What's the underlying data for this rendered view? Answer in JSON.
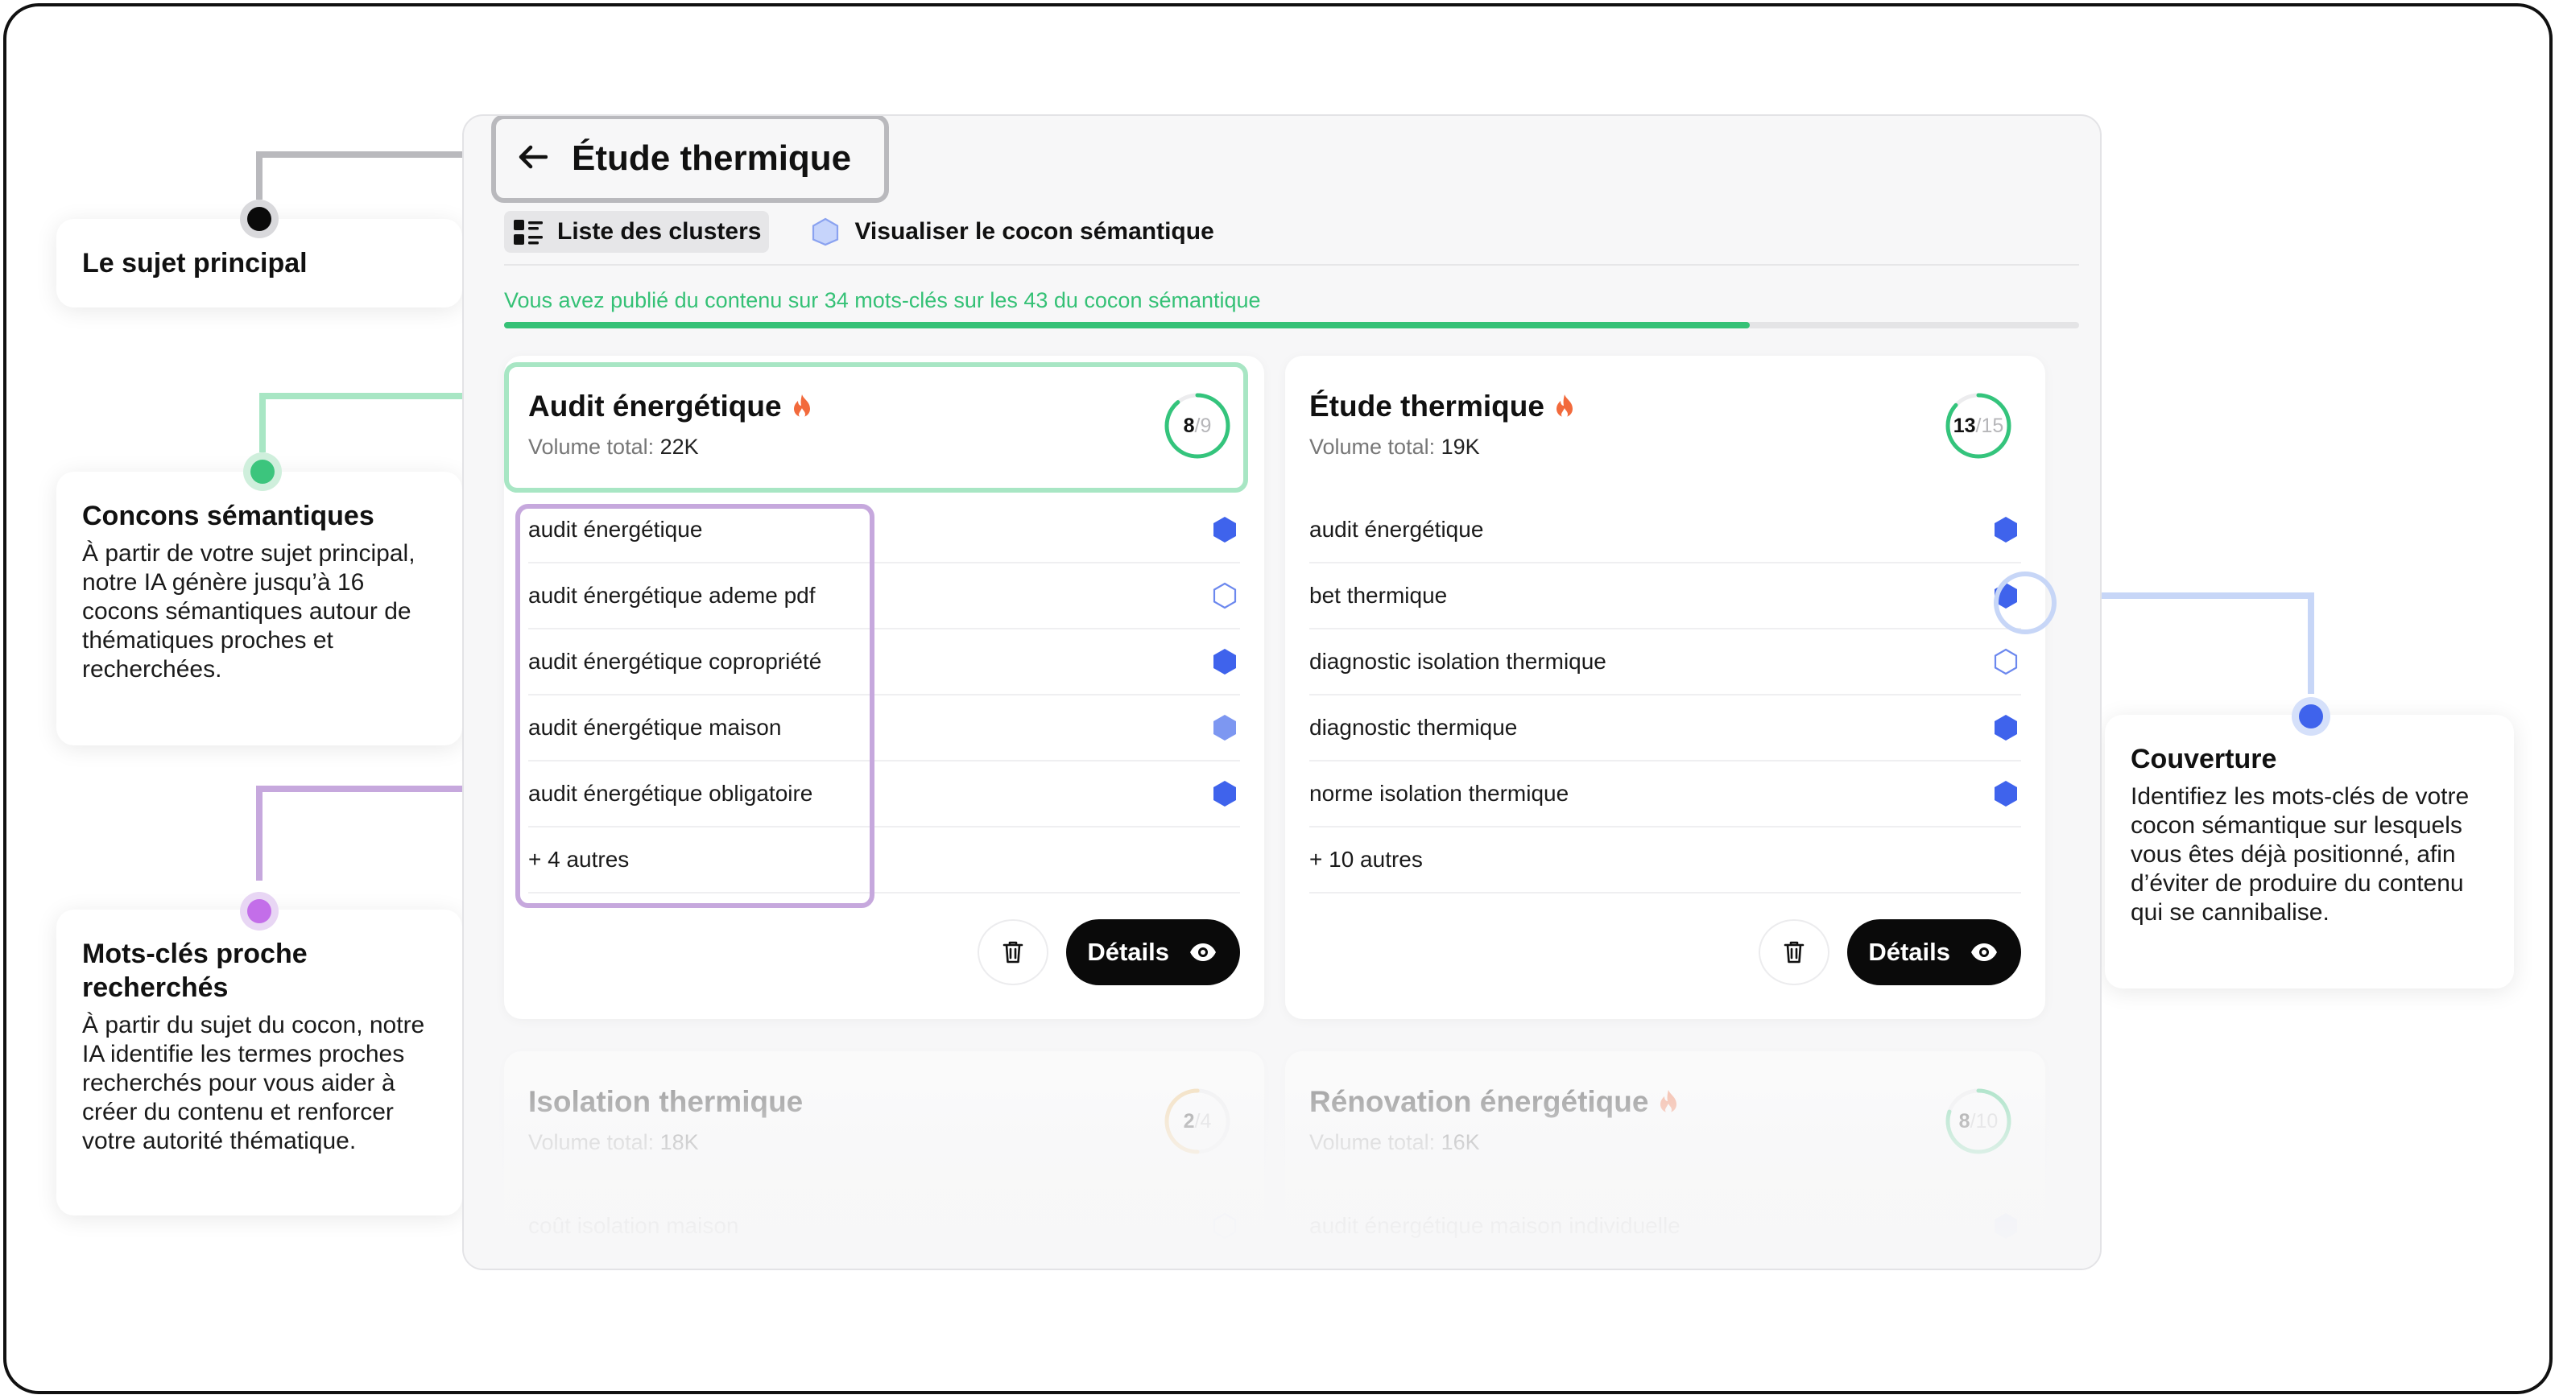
{
  "callouts": {
    "main_subject": {
      "title": "Le sujet principal"
    },
    "cocoons": {
      "title": "Concons sémantiques",
      "text": "À partir de votre sujet principal, notre IA génère jusqu’à 16 cocons sémantiques autour de thématiques proches et recherchées."
    },
    "keywords": {
      "title": "Mots-clés proche recherchés",
      "text": "À partir du sujet du cocon, notre IA identifie les termes proches recherchés pour vous aider à créer du contenu et renforcer votre autorité thématique."
    },
    "coverage": {
      "title": "Couverture",
      "text": "Identifiez les mots-clés de votre cocon sémantique sur lesquels vous êtes déjà positionné, afin d’éviter de produire du contenu qui se cannibalise."
    }
  },
  "header": {
    "back_icon": "arrow-left-icon",
    "title": "Étude thermique"
  },
  "tabs": [
    {
      "label": "Liste des clusters",
      "icon": "list-icon",
      "active": true
    },
    {
      "label": "Visualiser le cocon sémantique",
      "icon": "hexagon-icon",
      "active": false
    }
  ],
  "progress": {
    "text": "Vous avez publié du contenu sur 34 mots-clés sur les 43 du cocon sémantique",
    "published": 34,
    "total": 43
  },
  "colors": {
    "accent_green": "#35c176",
    "hex_blue": "#3f63ec",
    "flame": "#f26a3c",
    "ring_green": "#34c47c",
    "ring_orange": "#f0c070"
  },
  "clusters": [
    {
      "name": "Audit énergétique",
      "hot": true,
      "volume_label": "Volume total:",
      "volume": "22K",
      "score_done": "8",
      "score_sep": "/",
      "score_total": "9",
      "keywords": [
        {
          "text": "audit énergétique",
          "status": "full"
        },
        {
          "text": "audit énergétique ademe pdf",
          "status": "empty"
        },
        {
          "text": "audit énergétique copropriété",
          "status": "full"
        },
        {
          "text": "audit énergétique maison",
          "status": "partial"
        },
        {
          "text": "audit énergétique obligatoire",
          "status": "full"
        }
      ],
      "more": "+ 4 autres",
      "details_label": "Détails"
    },
    {
      "name": "Étude thermique",
      "hot": true,
      "volume_label": "Volume total:",
      "volume": "19K",
      "score_done": "13",
      "score_sep": "/",
      "score_total": "15",
      "keywords": [
        {
          "text": "audit énergétique",
          "status": "full"
        },
        {
          "text": "bet thermique",
          "status": "full"
        },
        {
          "text": "diagnostic isolation thermique",
          "status": "empty"
        },
        {
          "text": "diagnostic thermique",
          "status": "full"
        },
        {
          "text": "norme isolation thermique",
          "status": "full"
        }
      ],
      "more": "+ 10 autres",
      "details_label": "Détails"
    },
    {
      "name": "Isolation thermique",
      "hot": false,
      "volume_label": "Volume total:",
      "volume": "18K",
      "score_done": "2",
      "score_sep": "/",
      "score_total": "4",
      "keywords": [
        {
          "text": "coût isolation maison",
          "status": "empty"
        }
      ]
    },
    {
      "name": "Rénovation énergétique",
      "hot": true,
      "volume_label": "Volume total:",
      "volume": "16K",
      "score_done": "8",
      "score_sep": "/",
      "score_total": "10",
      "keywords": [
        {
          "text": "audit énergétique maison individuelle",
          "status": "partial"
        }
      ]
    }
  ]
}
